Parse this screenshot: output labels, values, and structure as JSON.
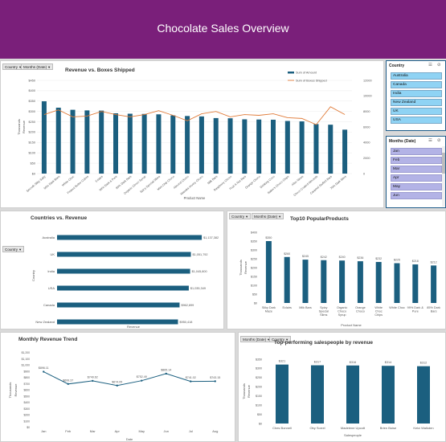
{
  "banner": {
    "title": "Chocolate Sales Overview"
  },
  "filters": {
    "country": "Country",
    "months": "Months (Date)"
  },
  "slicers": {
    "country": {
      "title": "Country",
      "items": [
        "Australia",
        "Canada",
        "India",
        "New Zealand",
        "UK",
        "USA"
      ]
    },
    "months": {
      "title": "Months (Date)",
      "items": [
        "Jan",
        "Feb",
        "Mar",
        "Apr",
        "May",
        "Jun"
      ]
    }
  },
  "chart_data": [
    {
      "id": "revenue_boxes",
      "type": "bar",
      "title": "Revenue vs. Boxes Shipped",
      "xlabel": "Product Name",
      "ylabel": "Revenue",
      "y_unit": "Thousands",
      "ylim": [
        0,
        450
      ],
      "yticks": [
        "$0",
        "$50",
        "$100",
        "$150",
        "$200",
        "$250",
        "$300",
        "$350",
        "$400",
        "$450"
      ],
      "y2lim": [
        0,
        12000
      ],
      "y2ticks": [
        "0",
        "2000",
        "4000",
        "6000",
        "8000",
        "10000",
        "12000"
      ],
      "legend": [
        "Sum of Amount",
        "Sum of Boxes Shipped"
      ],
      "categories": [
        "Smooth Sliky Salty",
        "50% Dark Bites",
        "White Choc",
        "Peanut Butter Cubes",
        "Eclairs",
        "99% Dark & Pure",
        "85% Dark Bars",
        "Organic Choco Syrup",
        "Spicy Special Slims",
        "Mint Chip Choco",
        "Almond Choco",
        "Manuka Honey Choco",
        "Milk Bars",
        "Raspberry Choco",
        "Fruit & Nut Bars",
        "Orange Choco",
        "Drinking Coco",
        "Baker's Choco Chips",
        "After Nines",
        "Choco Coated Almonds",
        "Caramel Stuffed Bars",
        "70% Dark Bites"
      ],
      "series": [
        {
          "name": "Sum of Amount",
          "values": [
            349,
            318,
            308,
            305,
            304,
            291,
            289,
            288,
            286,
            281,
            278,
            276,
            268,
            267,
            262,
            261,
            260,
            254,
            252,
            239,
            236,
            212
          ]
        },
        {
          "name": "Sum of Boxes Shipped",
          "values": [
            7600,
            8200,
            7300,
            7400,
            8000,
            7600,
            7300,
            7600,
            8100,
            7500,
            6800,
            7700,
            8000,
            7300,
            7600,
            7500,
            7700,
            7200,
            7100,
            6300,
            8600,
            7600
          ]
        }
      ]
    },
    {
      "id": "country_revenue",
      "type": "bar",
      "orientation": "horizontal",
      "title": "Countries vs. Revenue",
      "xlabel": "Revenue",
      "ylabel": "Country",
      "categories": [
        "Australia",
        "UK",
        "India",
        "USA",
        "Canada",
        "New Zealand"
      ],
      "values": [
        1137382,
        1051792,
        1045800,
        1035349,
        962899,
        950418
      ],
      "labels": [
        "$1,137,382",
        "$1,051,792",
        "$1,045,800",
        "$1,035,349",
        "$962,899",
        "$950,418"
      ],
      "xlim": [
        0,
        1200000
      ]
    },
    {
      "id": "top10_products",
      "type": "bar",
      "title": "Top10 PopularProducts",
      "xlabel": "Product Name",
      "ylabel": "Revenue",
      "y_unit": "Thousands",
      "ylim": [
        0,
        400
      ],
      "yticks": [
        "$0",
        "$50",
        "$100",
        "$150",
        "$200",
        "$250",
        "$300",
        "$350",
        "$400"
      ],
      "categories": [
        "Smooth Sliky Salty",
        "Eclairs",
        "Milk Bars",
        "Spicy Special Slims",
        "Organic Choco Syrup",
        "Orange Choco",
        "White Choc Chips",
        "White Choc",
        "50% Dark Bites Nut",
        "85% Dark Bars"
      ],
      "tick_labels": [
        [
          "Silky Dark",
          "Maze"
        ],
        [
          "Eclairs"
        ],
        [
          "Milk Bars"
        ],
        [
          "Spicy",
          "Special",
          "Slims"
        ],
        [
          "Organic",
          "Choco",
          "Syrup"
        ],
        [
          "Orange",
          "Choco"
        ],
        [
          "White",
          "Choc",
          "Chips"
        ],
        [
          "White Choc"
        ],
        [
          "99% Dark &",
          "Pure"
        ],
        [
          "85% Dark",
          "Bars"
        ]
      ],
      "values": [
        350,
        260,
        245,
        242,
        240,
        236,
        232,
        225,
        218,
        212
      ],
      "labels": [
        "$350",
        "$260",
        "$245",
        "$242",
        "$240",
        "$236",
        "$232",
        "$225",
        "$218",
        "$212"
      ]
    },
    {
      "id": "monthly_trend",
      "type": "line",
      "title": "Monthly Revenue Trend",
      "xlabel": "Date",
      "ylabel": "Revenue",
      "y_unit": "Thousands",
      "ylim": [
        0,
        1200
      ],
      "yticks": [
        "$0",
        "$100",
        "$200",
        "$300",
        "$400",
        "$500",
        "$600",
        "$700",
        "$800",
        "$900",
        "$1,000",
        "$1,100",
        "$1,200"
      ],
      "categories": [
        "Jan",
        "Feb",
        "Mar",
        "Apr",
        "May",
        "Jun",
        "Jul",
        "Aug"
      ],
      "values": [
        896.11,
        699.37,
        749.62,
        674.05,
        752.49,
        865.14,
        741.02,
        743.15
      ],
      "labels": [
        "$896.11",
        "$699.37",
        "$749.62",
        "$674.05",
        "$752.49",
        "$865.14",
        "$741.02",
        "$743.15"
      ]
    },
    {
      "id": "salespeople",
      "type": "bar",
      "title": "Top-performing salespeople by revenue",
      "xlabel": "Salespeople",
      "ylabel": "Revenue",
      "y_unit": "Thousands",
      "ylim": [
        0,
        350
      ],
      "yticks": [
        "$0",
        "$50",
        "$100",
        "$150",
        "$200",
        "$250",
        "$300",
        "$350"
      ],
      "categories": [
        "Ches Bonnell",
        "Oby Sorrel",
        "Madelene Upcott",
        "Brien Boise",
        "Kelci Walkden"
      ],
      "values": [
        321,
        317,
        316,
        314,
        312
      ],
      "labels": [
        "$321",
        "$317",
        "$316",
        "$314",
        "$312"
      ]
    }
  ]
}
